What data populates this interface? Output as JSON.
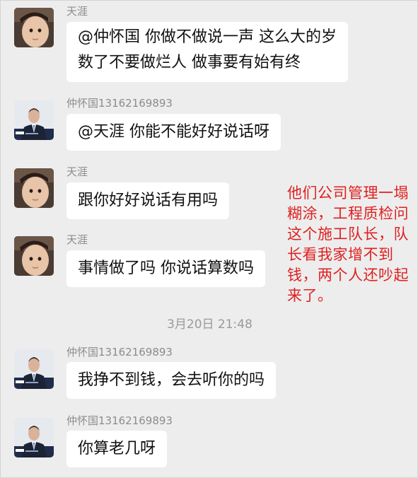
{
  "messages": [
    {
      "sender": "天涯",
      "avatar": "baby-avatar",
      "text": "@仲怀国 你做不做说一声 这么大的岁数了不要做烂人 做事要有始有终"
    },
    {
      "sender": "仲怀国13162169893",
      "avatar": "man-in-suit-avatar",
      "text": "@天涯 你能不能好好说话呀"
    },
    {
      "sender": "天涯",
      "avatar": "baby-avatar",
      "text": "跟你好好说话有用吗"
    },
    {
      "sender": "天涯",
      "avatar": "baby-avatar",
      "text": "事情做了吗 你说话算数吗"
    },
    {
      "sender": "仲怀国13162169893",
      "avatar": "man-in-suit-avatar",
      "text": "我挣不到钱，会去听你的吗"
    },
    {
      "sender": "仲怀国13162169893",
      "avatar": "man-in-suit-avatar",
      "text": "你算老几呀"
    }
  ],
  "timestamp": "3月20日 21:48",
  "annotation": "他们公司管理一塌糊涂，工程质检问这个施工队长，队长看我家增不到钱，两个人还吵起来了。",
  "colors": {
    "background": "#ededed",
    "bubble": "#ffffff",
    "sender": "#8c8c8c",
    "annotation": "#e02020"
  }
}
